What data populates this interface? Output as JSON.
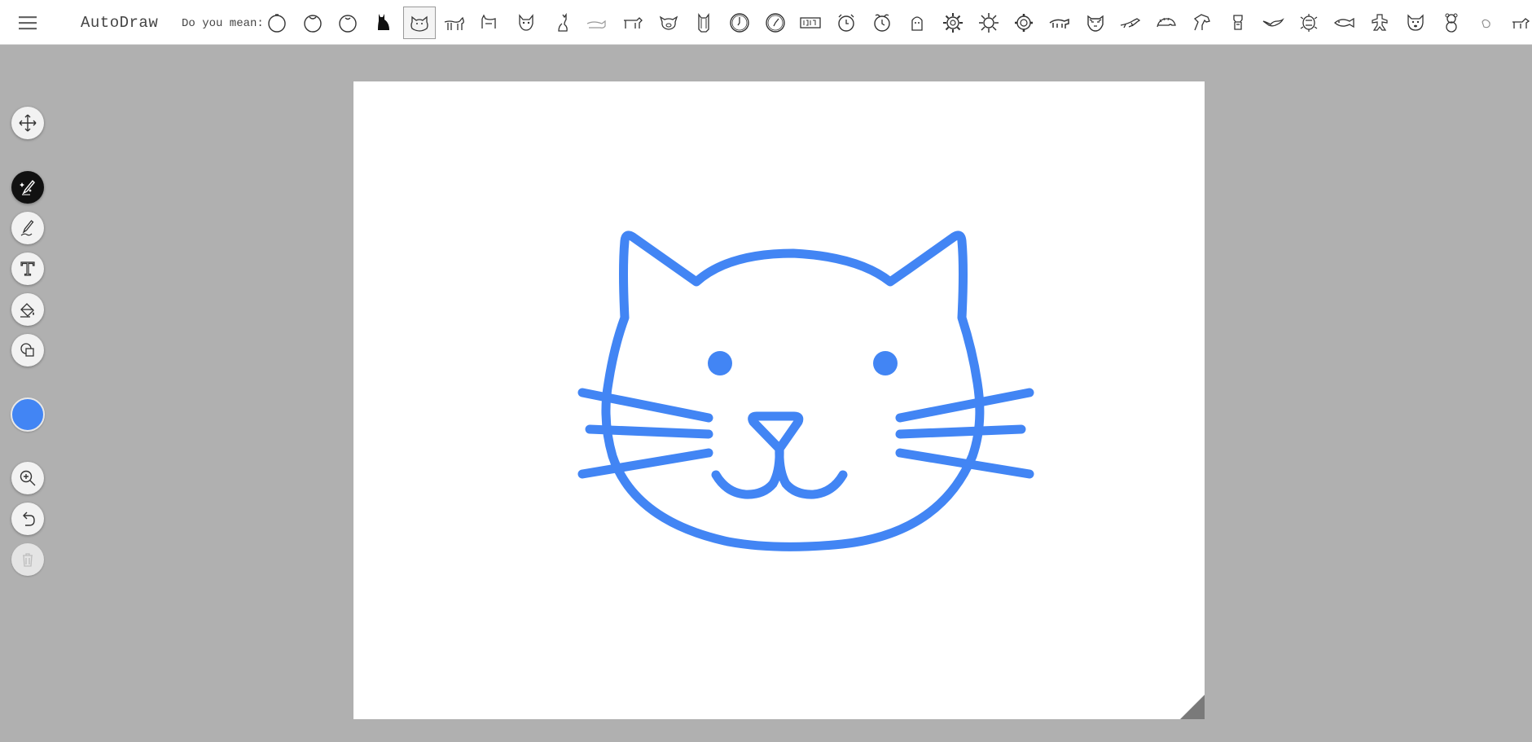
{
  "app": {
    "title": "AutoDraw"
  },
  "topbar": {
    "menu_icon": "hamburger-icon",
    "suggest_label": "Do you mean:",
    "selected_index": 4,
    "suggestions": [
      "circle-icon",
      "circle-icon",
      "circle-icon",
      "cat-silhouette-icon",
      "cat-face-icon",
      "cat-walking-icon",
      "cat-icon",
      "cat-face-icon",
      "cat-sitting-icon",
      "cat-lying-icon",
      "dog-icon",
      "pig-face-icon",
      "owl-icon",
      "clock-icon",
      "clock-icon",
      "digital-clock-icon",
      "alarm-clock-icon",
      "alarm-clock-icon",
      "face-icon",
      "gear-icon",
      "sun-icon",
      "gear-icon",
      "animal-icon",
      "tiger-face-icon",
      "lizard-icon",
      "hedgehog-icon",
      "horse-icon",
      "lamp-icon",
      "bird-icon",
      "turtle-icon",
      "fish-icon",
      "gingerbread-icon",
      "dog-face-icon",
      "teddy-bear-icon",
      "bird-icon",
      "animal-icon"
    ]
  },
  "toolbar": {
    "tools": [
      {
        "name": "move-tool",
        "icon": "move-icon"
      },
      {
        "name": "autodraw-tool",
        "icon": "magic-pen-icon",
        "active": true
      },
      {
        "name": "draw-tool",
        "icon": "pencil-icon"
      },
      {
        "name": "type-tool",
        "icon": "text-icon"
      },
      {
        "name": "fill-tool",
        "icon": "paint-bucket-icon"
      },
      {
        "name": "shape-tool",
        "icon": "shapes-icon"
      },
      {
        "name": "zoom-tool",
        "icon": "zoom-in-icon"
      },
      {
        "name": "undo-button",
        "icon": "undo-icon"
      },
      {
        "name": "delete-button",
        "icon": "trash-icon",
        "disabled": true
      }
    ],
    "current_color": "#4285f4"
  },
  "canvas": {
    "stroke_color": "#4285f4",
    "drawing": "cat-face"
  }
}
